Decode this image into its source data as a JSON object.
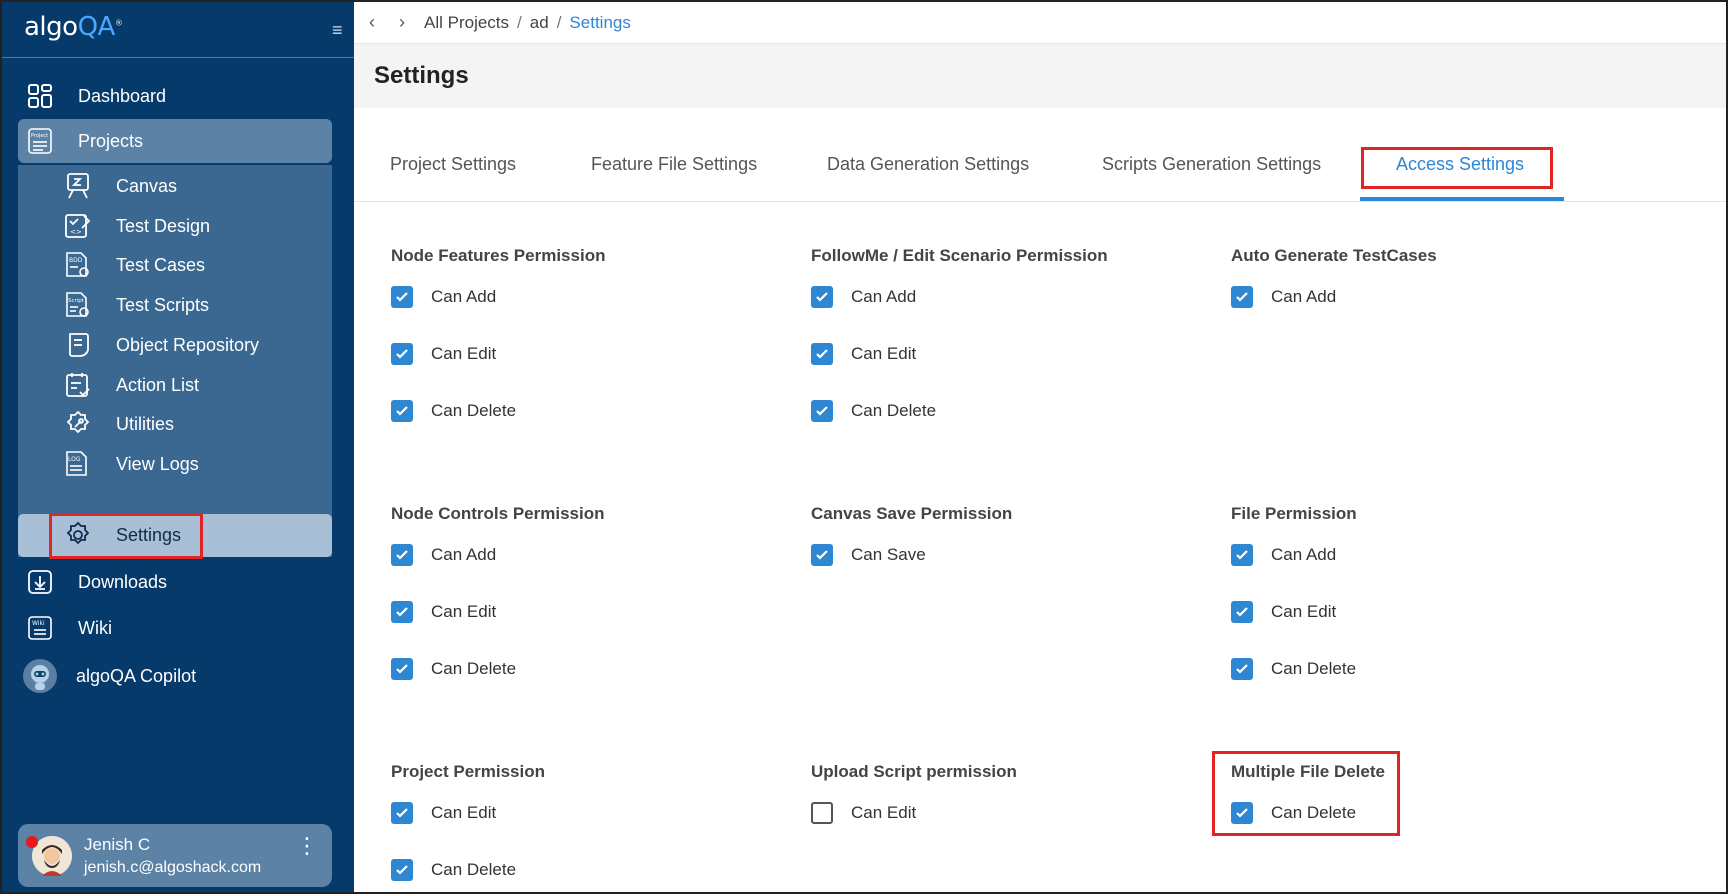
{
  "app": {
    "brand_prefix": "algo",
    "brand_accent": "QA",
    "brand_mark": "®"
  },
  "sidebar": {
    "items": [
      {
        "label": "Dashboard",
        "icon": "dashboard-icon"
      },
      {
        "label": "Projects",
        "icon": "projects-icon"
      },
      {
        "label": "Downloads",
        "icon": "download-icon"
      },
      {
        "label": "Wiki",
        "icon": "wiki-icon"
      },
      {
        "label": "algoQA Copilot",
        "icon": "copilot-icon"
      }
    ],
    "project_items": [
      {
        "label": "Canvas",
        "icon": "canvas-icon"
      },
      {
        "label": "Test Design",
        "icon": "test-design-icon"
      },
      {
        "label": "Test Cases",
        "icon": "test-cases-icon"
      },
      {
        "label": "Test Scripts",
        "icon": "test-scripts-icon"
      },
      {
        "label": "Object Repository",
        "icon": "object-repository-icon"
      },
      {
        "label": "Action List",
        "icon": "action-list-icon"
      },
      {
        "label": "Utilities",
        "icon": "utilities-icon"
      },
      {
        "label": "View Logs",
        "icon": "view-logs-icon"
      },
      {
        "label": "Settings",
        "icon": "gear-icon",
        "active": true
      }
    ]
  },
  "user": {
    "name": "Jenish C",
    "email": "jenish.c@algoshack.com"
  },
  "breadcrumb": {
    "items": [
      "All Projects",
      "ad",
      "Settings"
    ],
    "separator": "/"
  },
  "page": {
    "title": "Settings"
  },
  "tabs": [
    {
      "label": "Project Settings",
      "active": false
    },
    {
      "label": "Feature File Settings",
      "active": false
    },
    {
      "label": "Data Generation Settings",
      "active": false
    },
    {
      "label": "Scripts Generation Settings",
      "active": false
    },
    {
      "label": "Access Settings",
      "active": true
    }
  ],
  "permissions": [
    {
      "title": "Node Features Permission",
      "options": [
        {
          "label": "Can Add",
          "checked": true
        },
        {
          "label": "Can Edit",
          "checked": true
        },
        {
          "label": "Can Delete",
          "checked": true
        }
      ]
    },
    {
      "title": "FollowMe / Edit Scenario Permission",
      "options": [
        {
          "label": "Can Add",
          "checked": true
        },
        {
          "label": "Can Edit",
          "checked": true
        },
        {
          "label": "Can Delete",
          "checked": true
        }
      ]
    },
    {
      "title": "Auto Generate TestCases",
      "options": [
        {
          "label": "Can Add",
          "checked": true
        }
      ]
    },
    {
      "title": "Node Controls Permission",
      "options": [
        {
          "label": "Can Add",
          "checked": true
        },
        {
          "label": "Can Edit",
          "checked": true
        },
        {
          "label": "Can Delete",
          "checked": true
        }
      ]
    },
    {
      "title": "Canvas Save Permission",
      "options": [
        {
          "label": "Can Save",
          "checked": true
        }
      ]
    },
    {
      "title": "File Permission",
      "options": [
        {
          "label": "Can Add",
          "checked": true
        },
        {
          "label": "Can Edit",
          "checked": true
        },
        {
          "label": "Can Delete",
          "checked": true
        }
      ]
    },
    {
      "title": "Project Permission",
      "options": [
        {
          "label": "Can Edit",
          "checked": true
        },
        {
          "label": "Can Delete",
          "checked": true
        }
      ]
    },
    {
      "title": "Upload Script permission",
      "options": [
        {
          "label": "Can Edit",
          "checked": false
        }
      ]
    },
    {
      "title": "Multiple File Delete",
      "options": [
        {
          "label": "Can Delete",
          "checked": true
        }
      ]
    }
  ],
  "colors": {
    "sidebar_bg": "#063a6b",
    "accent": "#2b86d6",
    "highlight_border": "#e02525",
    "checkbox": "#2e87d2"
  }
}
